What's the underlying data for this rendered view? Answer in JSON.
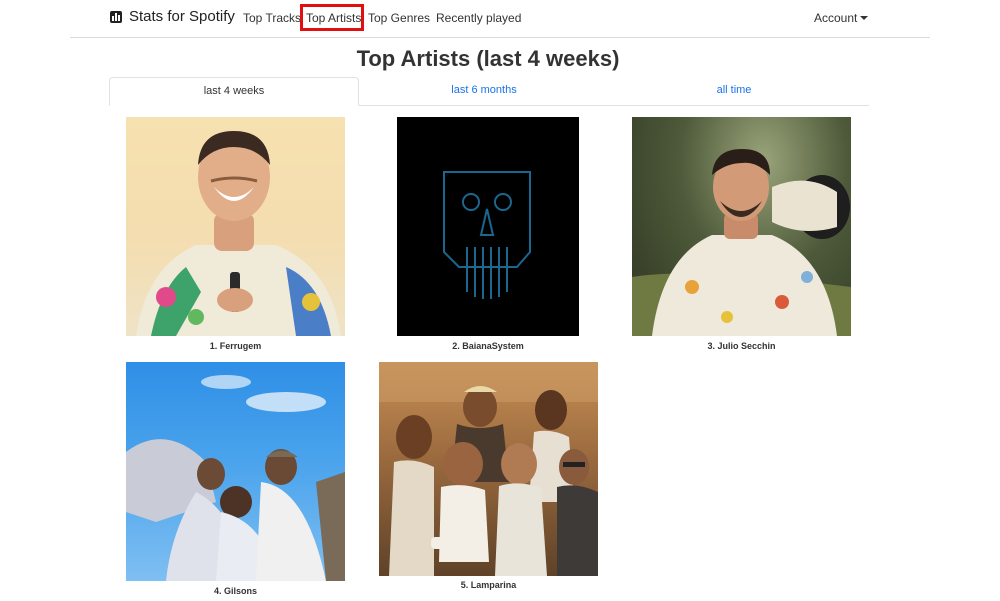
{
  "navbar": {
    "brand": "Stats for Spotify",
    "links": [
      "Top Tracks",
      "Top Artists",
      "Top Genres",
      "Recently played"
    ],
    "account": "Account"
  },
  "page": {
    "title": "Top Artists (last 4 weeks)"
  },
  "tabs": [
    "last 4 weeks",
    "last 6 months",
    "all time"
  ],
  "artists": [
    {
      "label": "1. Ferrugem"
    },
    {
      "label": "2. BaianaSystem"
    },
    {
      "label": "3. Julio Secchin"
    },
    {
      "label": "4. Gilsons"
    },
    {
      "label": "5. Lamparina"
    }
  ],
  "colors": {
    "link": "#1a73e8",
    "highlight_box": "#e01010"
  }
}
